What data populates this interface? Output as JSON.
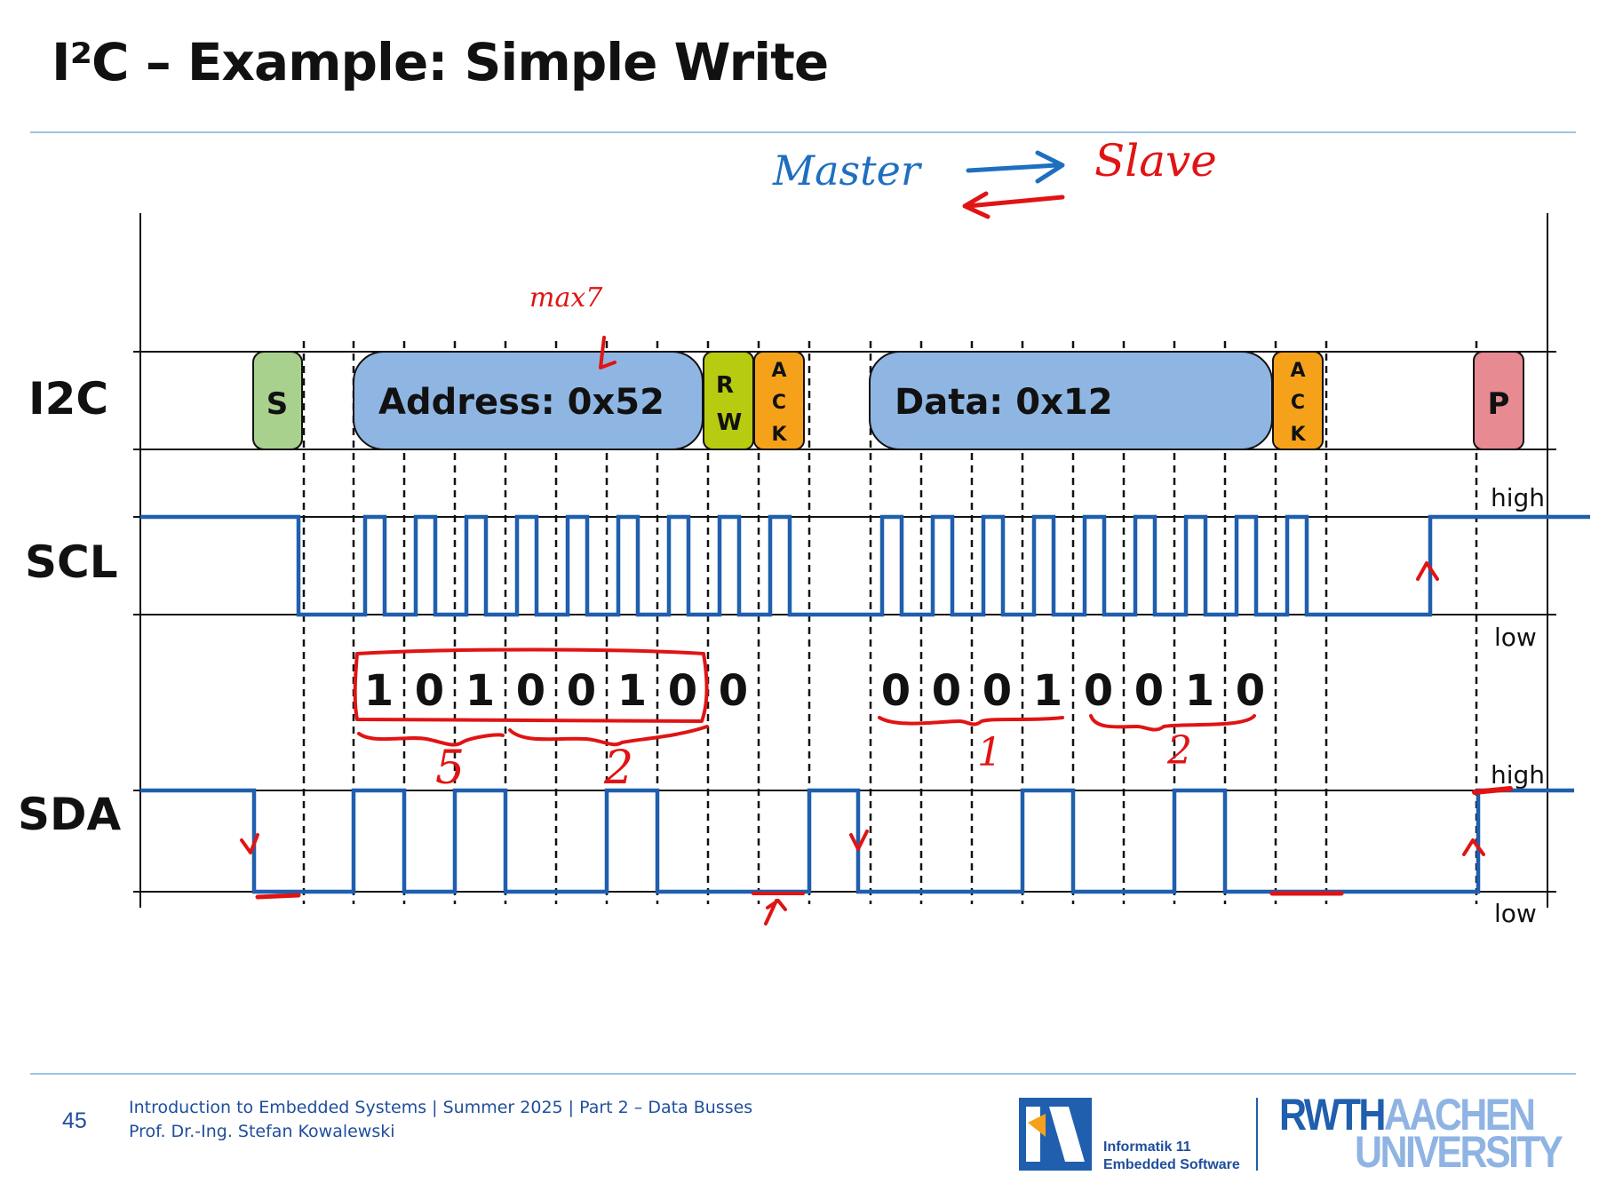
{
  "slide": {
    "title": "I²C – Example: Simple Write",
    "page_number": "45",
    "footer_line1": "Introduction to Embedded Systems | Summer 2025 | Part 2 – Data Busses",
    "footer_line2": "Prof. Dr.-Ing. Stefan Kowalewski",
    "logo_line1": "Informatik 11",
    "logo_line2": "Embedded Software",
    "univ_rwth": "RWTH",
    "univ_aachen": "AACHEN",
    "univ_university": "UNIVERSITY"
  },
  "diagram": {
    "row_labels": [
      "I2C",
      "SCL",
      "SDA"
    ],
    "level_labels": {
      "high": "high",
      "low": "low"
    },
    "frame": {
      "start": "S",
      "address": "Address: 0x52",
      "rw": [
        "R",
        "W"
      ],
      "ack": [
        "A",
        "C",
        "K"
      ],
      "data": "Data: 0x12",
      "stop": "P"
    },
    "address_bits": [
      "1",
      "0",
      "1",
      "0",
      "0",
      "1",
      "0"
    ],
    "rw_bit": "0",
    "data_bits": [
      "0",
      "0",
      "0",
      "1",
      "0",
      "0",
      "1",
      "0"
    ],
    "colors": {
      "signal": "#1f5fae",
      "start": "#a9d18e",
      "address": "#8fb6e2",
      "rw": "#b7cc10",
      "ack": "#f5a21a",
      "stop": "#e88a92",
      "ink_blue": "#1f6fc0",
      "ink_red": "#e01414"
    }
  },
  "annotations": {
    "master": "Master",
    "slave": "Slave",
    "max7": "max7",
    "addr_hi": "5",
    "addr_lo": "2",
    "data_hi": "1",
    "data_lo": "2"
  }
}
